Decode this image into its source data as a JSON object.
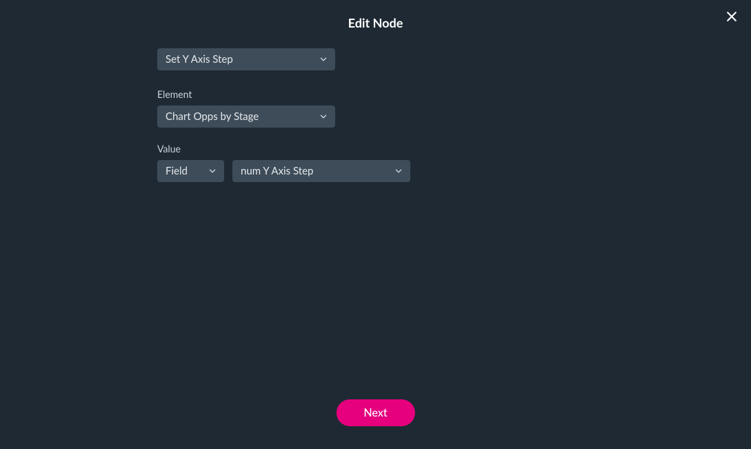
{
  "modal": {
    "title": "Edit Node"
  },
  "action": {
    "selected": "Set Y Axis Step"
  },
  "element": {
    "label": "Element",
    "selected": "Chart Opps by Stage"
  },
  "value": {
    "label": "Value",
    "type_selected": "Field",
    "field_selected": "num Y Axis Step"
  },
  "buttons": {
    "next": "Next"
  }
}
